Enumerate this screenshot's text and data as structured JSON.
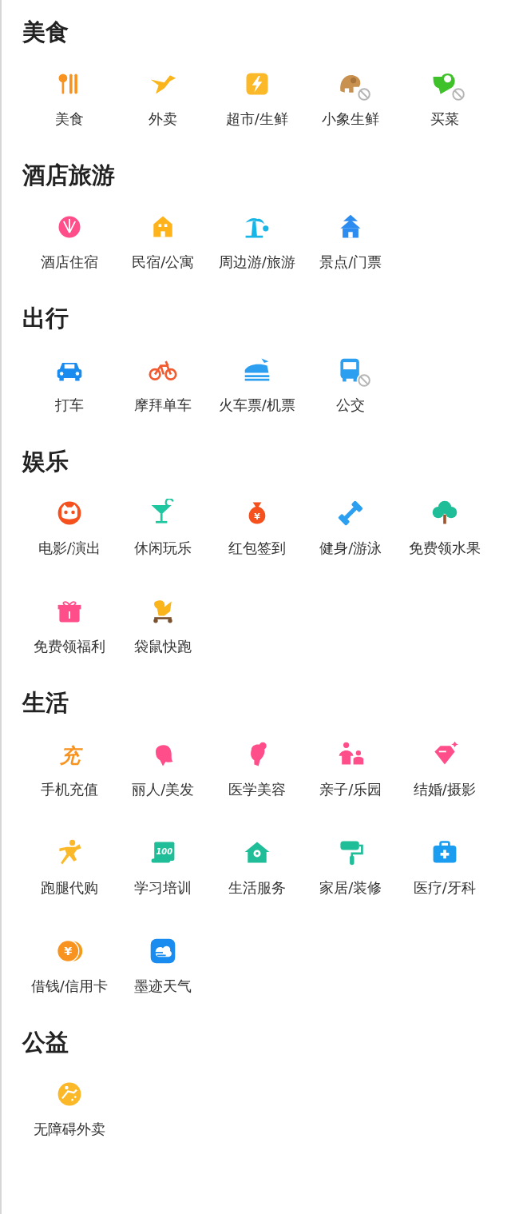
{
  "sections": [
    {
      "title": "美食",
      "items": [
        {
          "label": "美食",
          "unavailable": false
        },
        {
          "label": "外卖",
          "unavailable": false
        },
        {
          "label": "超市/生鲜",
          "unavailable": false
        },
        {
          "label": "小象生鲜",
          "unavailable": true
        },
        {
          "label": "买菜",
          "unavailable": true
        }
      ]
    },
    {
      "title": "酒店旅游",
      "items": [
        {
          "label": "酒店住宿",
          "unavailable": false
        },
        {
          "label": "民宿/公寓",
          "unavailable": false
        },
        {
          "label": "周边游/旅游",
          "unavailable": false
        },
        {
          "label": "景点/门票",
          "unavailable": false
        }
      ]
    },
    {
      "title": "出行",
      "items": [
        {
          "label": "打车",
          "unavailable": false
        },
        {
          "label": "摩拜单车",
          "unavailable": false
        },
        {
          "label": "火车票/机票",
          "unavailable": false
        },
        {
          "label": "公交",
          "unavailable": true
        }
      ]
    },
    {
      "title": "娱乐",
      "items": [
        {
          "label": "电影/演出",
          "unavailable": false
        },
        {
          "label": "休闲玩乐",
          "unavailable": false
        },
        {
          "label": "红包签到",
          "unavailable": false,
          "glyph": "¥"
        },
        {
          "label": "健身/游泳",
          "unavailable": false
        },
        {
          "label": "免费领水果",
          "unavailable": false
        },
        {
          "label": "免费领福利",
          "unavailable": false
        },
        {
          "label": "袋鼠快跑",
          "unavailable": false
        }
      ]
    },
    {
      "title": "生活",
      "items": [
        {
          "label": "手机充值",
          "unavailable": false,
          "glyph": "充"
        },
        {
          "label": "丽人/美发",
          "unavailable": false
        },
        {
          "label": "医学美容",
          "unavailable": false
        },
        {
          "label": "亲子/乐园",
          "unavailable": false
        },
        {
          "label": "结婚/摄影",
          "unavailable": false
        },
        {
          "label": "跑腿代购",
          "unavailable": false
        },
        {
          "label": "学习培训",
          "unavailable": false,
          "glyph": "100"
        },
        {
          "label": "生活服务",
          "unavailable": false
        },
        {
          "label": "家居/装修",
          "unavailable": false
        },
        {
          "label": "医疗/牙科",
          "unavailable": false
        },
        {
          "label": "借钱/信用卡",
          "unavailable": false,
          "glyph": "¥"
        },
        {
          "label": "墨迹天气",
          "unavailable": false
        }
      ]
    },
    {
      "title": "公益",
      "items": [
        {
          "label": "无障碍外卖",
          "unavailable": false
        }
      ]
    }
  ]
}
